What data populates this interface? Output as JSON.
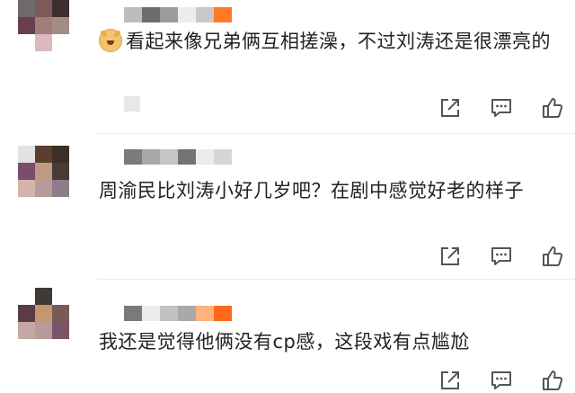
{
  "comments": [
    {
      "avatar_colors": [
        "#6e6a6a",
        "#7e5a5a",
        "#3e2e2e",
        "#6a3f4f",
        "#a07f7a",
        "#a28d85",
        "#ffffff",
        "#dcb8c0",
        "#ffffff"
      ],
      "name_colors": [
        "#ffffff",
        "#bdbdbd",
        "#6d6d6d",
        "#9b9b9b",
        "#ececec",
        "#c8c8c8",
        "#ff7a24"
      ],
      "emoji": "dog-face-emoji",
      "text": "看起来像兄弟俩互相搓澡，不过刘涛还是很漂亮的",
      "meta_colors": [
        "#e8e8e8"
      ]
    },
    {
      "avatar_colors": [
        "#e2e2e2",
        "#5a3e2f",
        "#3d2e27",
        "#7a4d6b",
        "#c09a80",
        "#4a3a33",
        "#d3b4a8",
        "#b49d99",
        "#8f7b8e"
      ],
      "name_colors": [
        "#ffffff",
        "#7b7b7b",
        "#a8a8a8",
        "#c5c5c5",
        "#737373",
        "#ececec",
        "#d6d6d6"
      ],
      "emoji": "",
      "text": "周渝民比刘涛小好几岁吧？在剧中感觉好老的样子",
      "meta_colors": []
    },
    {
      "avatar_colors": [
        "#ffffff",
        "#3d3a38",
        "#ffffff",
        "#5a3c48",
        "#c7966b",
        "#7a5a56",
        "#c4a8a4",
        "#b89a9a",
        "#7a5468"
      ],
      "name_colors": [
        "#ffffff",
        "#7a7a7a",
        "#ececec",
        "#c2c2c2",
        "#a9a9a9",
        "#ffb180",
        "#ff6a1a"
      ],
      "emoji": "",
      "text": "我还是觉得他俩没有cp感，这段戏有点尴尬",
      "meta_colors": []
    }
  ],
  "actions": {
    "share_icon": "share-icon",
    "comment_icon": "comment-icon",
    "like_icon": "like-icon"
  },
  "colors": {
    "icon": "#555555",
    "divider": "#ececec"
  }
}
